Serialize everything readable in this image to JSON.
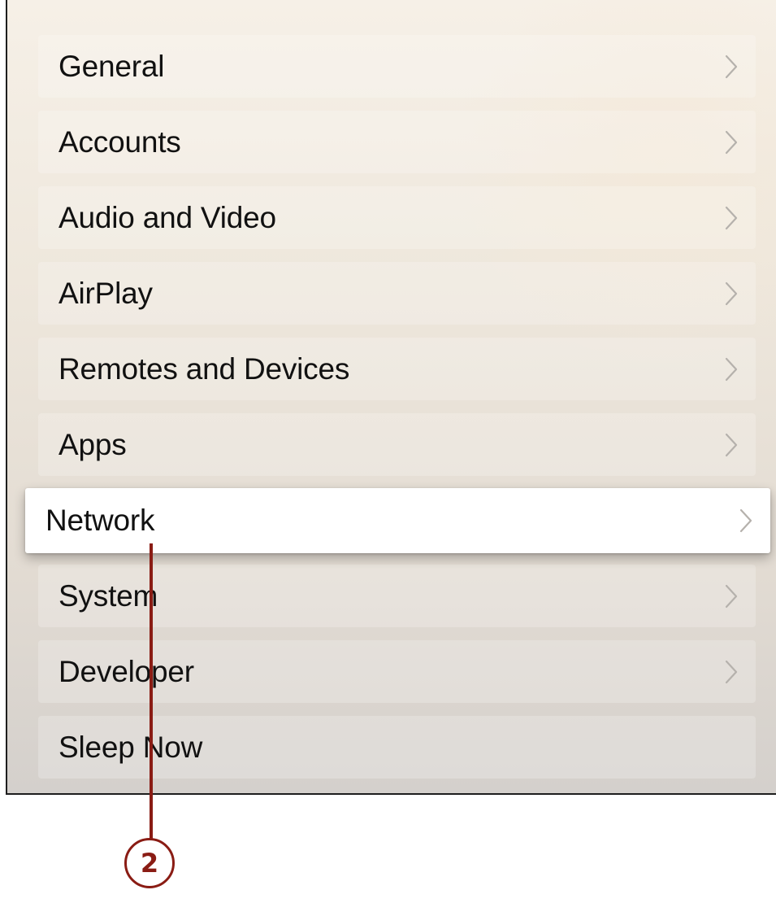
{
  "settings_menu": {
    "items": [
      {
        "label": "General",
        "has_chevron": true
      },
      {
        "label": "Accounts",
        "has_chevron": true
      },
      {
        "label": "Audio and Video",
        "has_chevron": true
      },
      {
        "label": "AirPlay",
        "has_chevron": true
      },
      {
        "label": "Remotes and Devices",
        "has_chevron": true
      },
      {
        "label": "Apps",
        "has_chevron": true
      },
      {
        "label": "Network",
        "has_chevron": true,
        "focused": true
      },
      {
        "label": "System",
        "has_chevron": true
      },
      {
        "label": "Developer",
        "has_chevron": true
      },
      {
        "label": "Sleep Now",
        "has_chevron": false
      }
    ]
  },
  "callout": {
    "number": "2",
    "color": "#8a1c14"
  },
  "colors": {
    "focused_background": "#ffffff",
    "label_text": "#111111",
    "chevron": "#b5b1ac"
  },
  "icons": {
    "chevron": "chevron-right-icon"
  }
}
